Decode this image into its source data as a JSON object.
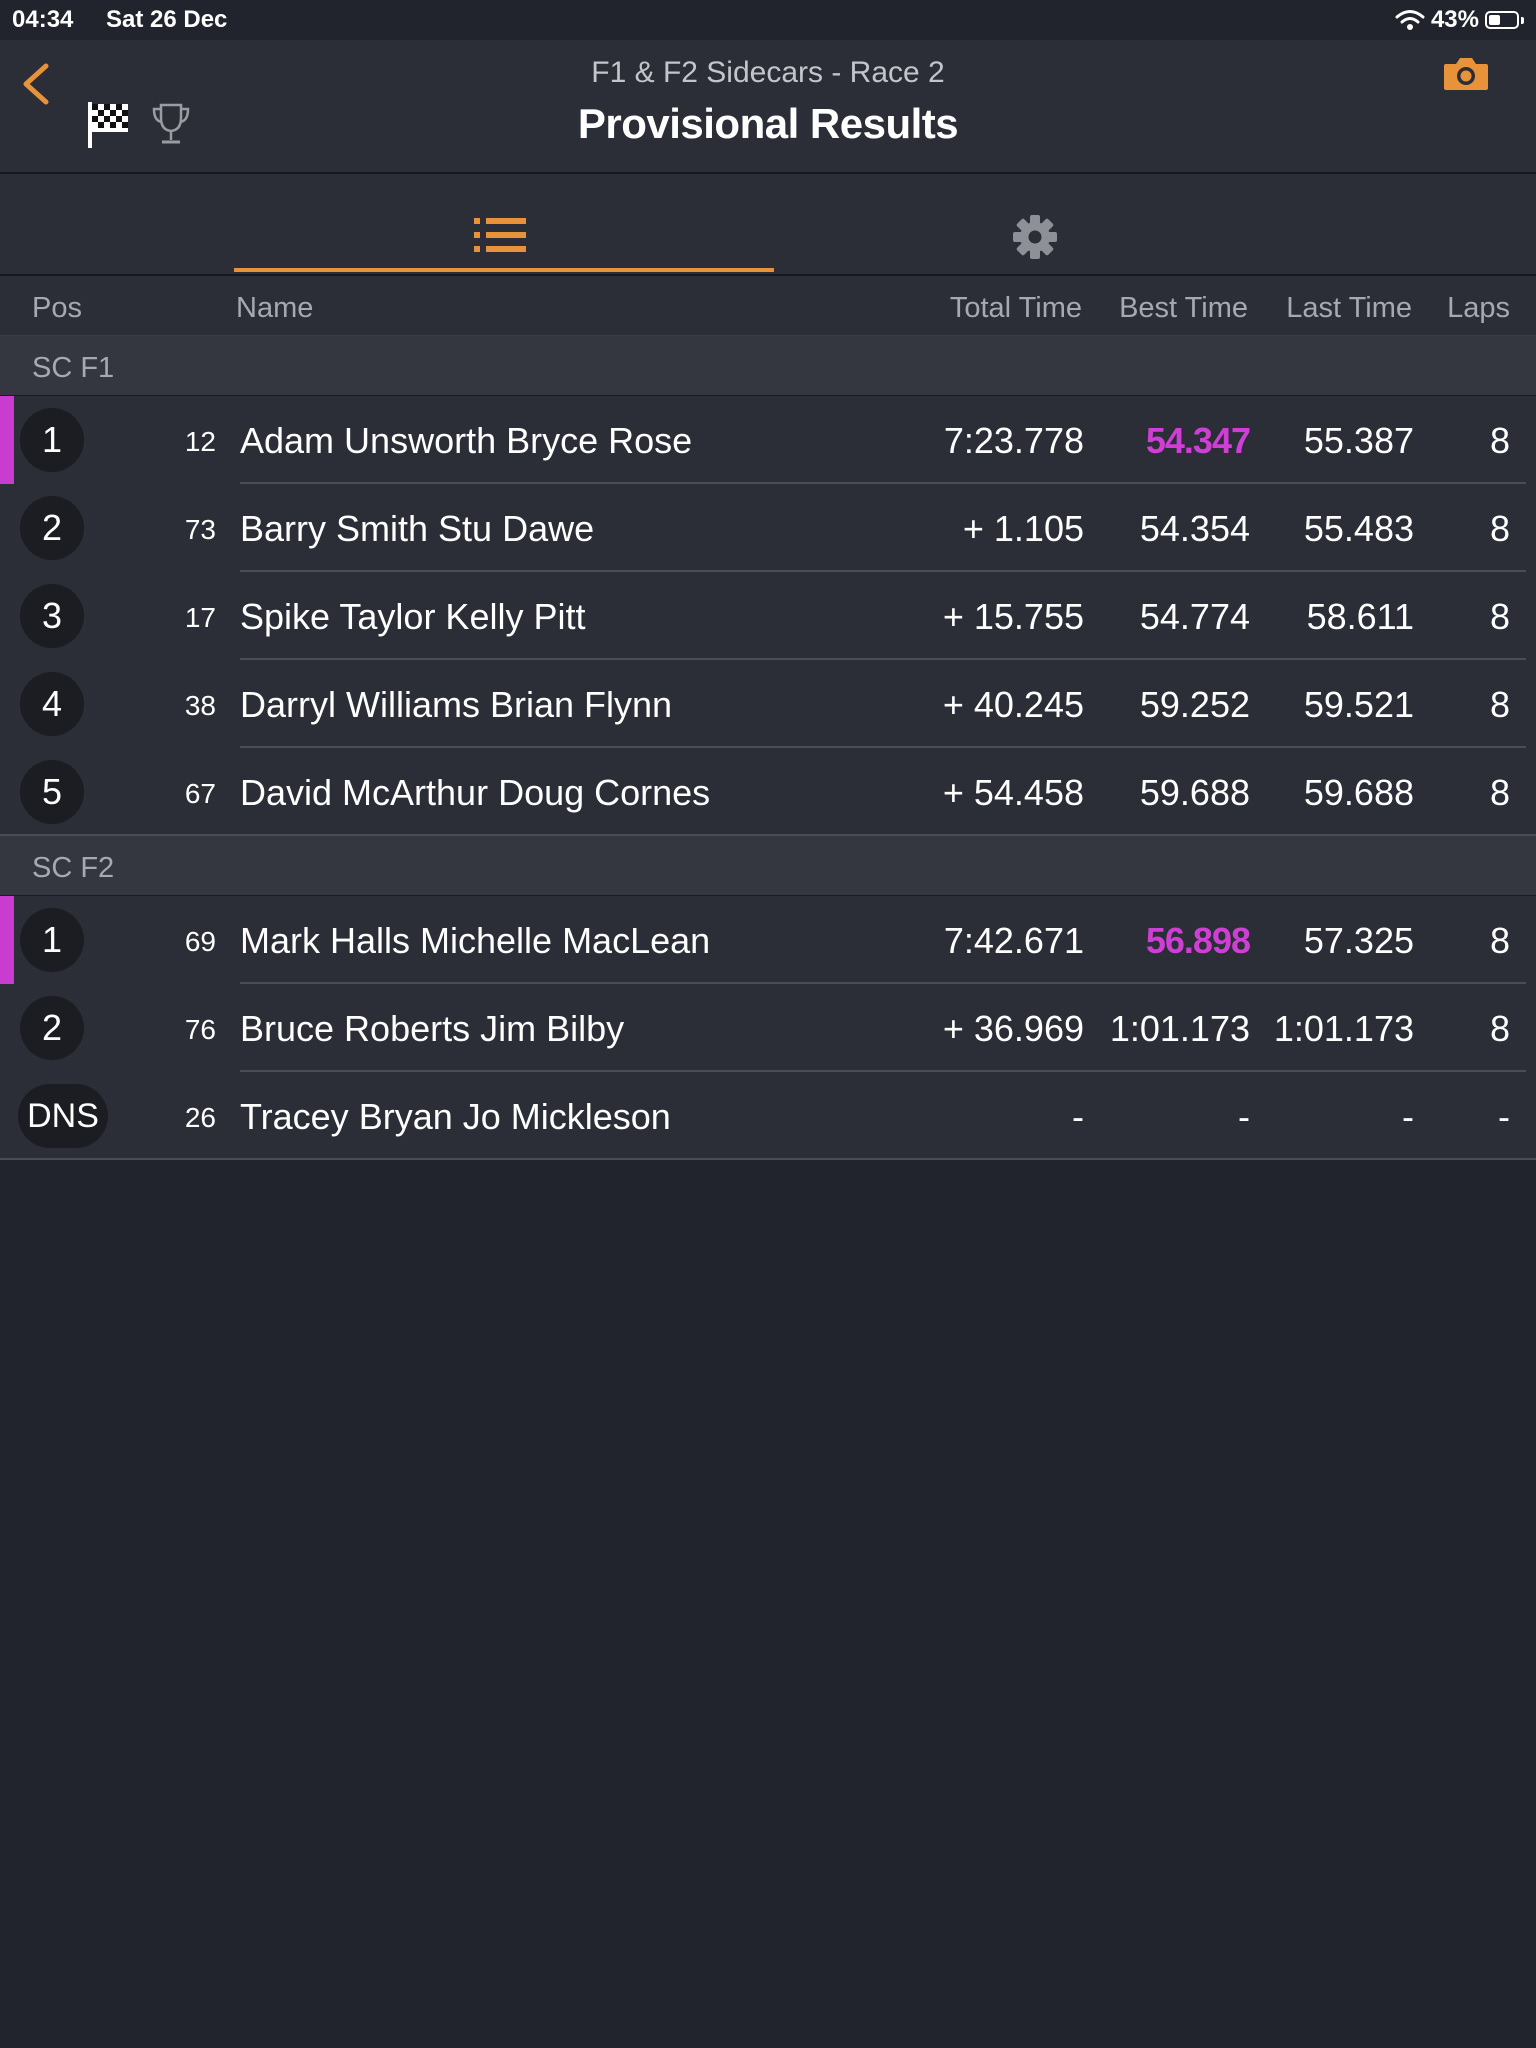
{
  "status": {
    "time": "04:34",
    "date": "Sat 26 Dec",
    "battery": "43%",
    "battery_level": 0.43
  },
  "header": {
    "subtitle": "F1 & F2 Sidecars - Race 2",
    "title": "Provisional Results"
  },
  "icons": {
    "back": "back-chevron-icon",
    "flag": "checkered-flag-icon",
    "trophy": "trophy-icon",
    "camera": "camera-icon",
    "list": "list-icon",
    "settings": "gear-icon"
  },
  "colors": {
    "accent": "#e8923a",
    "fastest": "#cf3fd6",
    "background": "#21242c"
  },
  "columns": {
    "pos": "Pos",
    "name": "Name",
    "total": "Total Time",
    "best": "Best Time",
    "last": "Last Time",
    "laps": "Laps"
  },
  "groups": [
    {
      "name": "SC F1",
      "rows": [
        {
          "pos": "1",
          "num": "12",
          "name": "Adam Unsworth Bryce Rose",
          "total": "7:23.778",
          "best": "54.347",
          "last": "55.387",
          "laps": "8",
          "fastest": true
        },
        {
          "pos": "2",
          "num": "73",
          "name": "Barry Smith Stu Dawe",
          "total": "+ 1.105",
          "best": "54.354",
          "last": "55.483",
          "laps": "8",
          "fastest": false
        },
        {
          "pos": "3",
          "num": "17",
          "name": "Spike Taylor Kelly Pitt",
          "total": "+ 15.755",
          "best": "54.774",
          "last": "58.611",
          "laps": "8",
          "fastest": false
        },
        {
          "pos": "4",
          "num": "38",
          "name": "Darryl Williams Brian Flynn",
          "total": "+ 40.245",
          "best": "59.252",
          "last": "59.521",
          "laps": "8",
          "fastest": false
        },
        {
          "pos": "5",
          "num": "67",
          "name": "David McArthur Doug Cornes",
          "total": "+ 54.458",
          "best": "59.688",
          "last": "59.688",
          "laps": "8",
          "fastest": false
        }
      ]
    },
    {
      "name": "SC F2",
      "rows": [
        {
          "pos": "1",
          "num": "69",
          "name": "Mark Halls Michelle MacLean",
          "total": "7:42.671",
          "best": "56.898",
          "last": "57.325",
          "laps": "8",
          "fastest": true
        },
        {
          "pos": "2",
          "num": "76",
          "name": "Bruce Roberts Jim Bilby",
          "total": "+ 36.969",
          "best": "1:01.173",
          "last": "1:01.173",
          "laps": "8",
          "fastest": false
        },
        {
          "pos": "DNS",
          "num": "26",
          "name": "Tracey Bryan Jo Mickleson",
          "total": "-",
          "best": "-",
          "last": "-",
          "laps": "-",
          "fastest": false
        }
      ]
    }
  ]
}
